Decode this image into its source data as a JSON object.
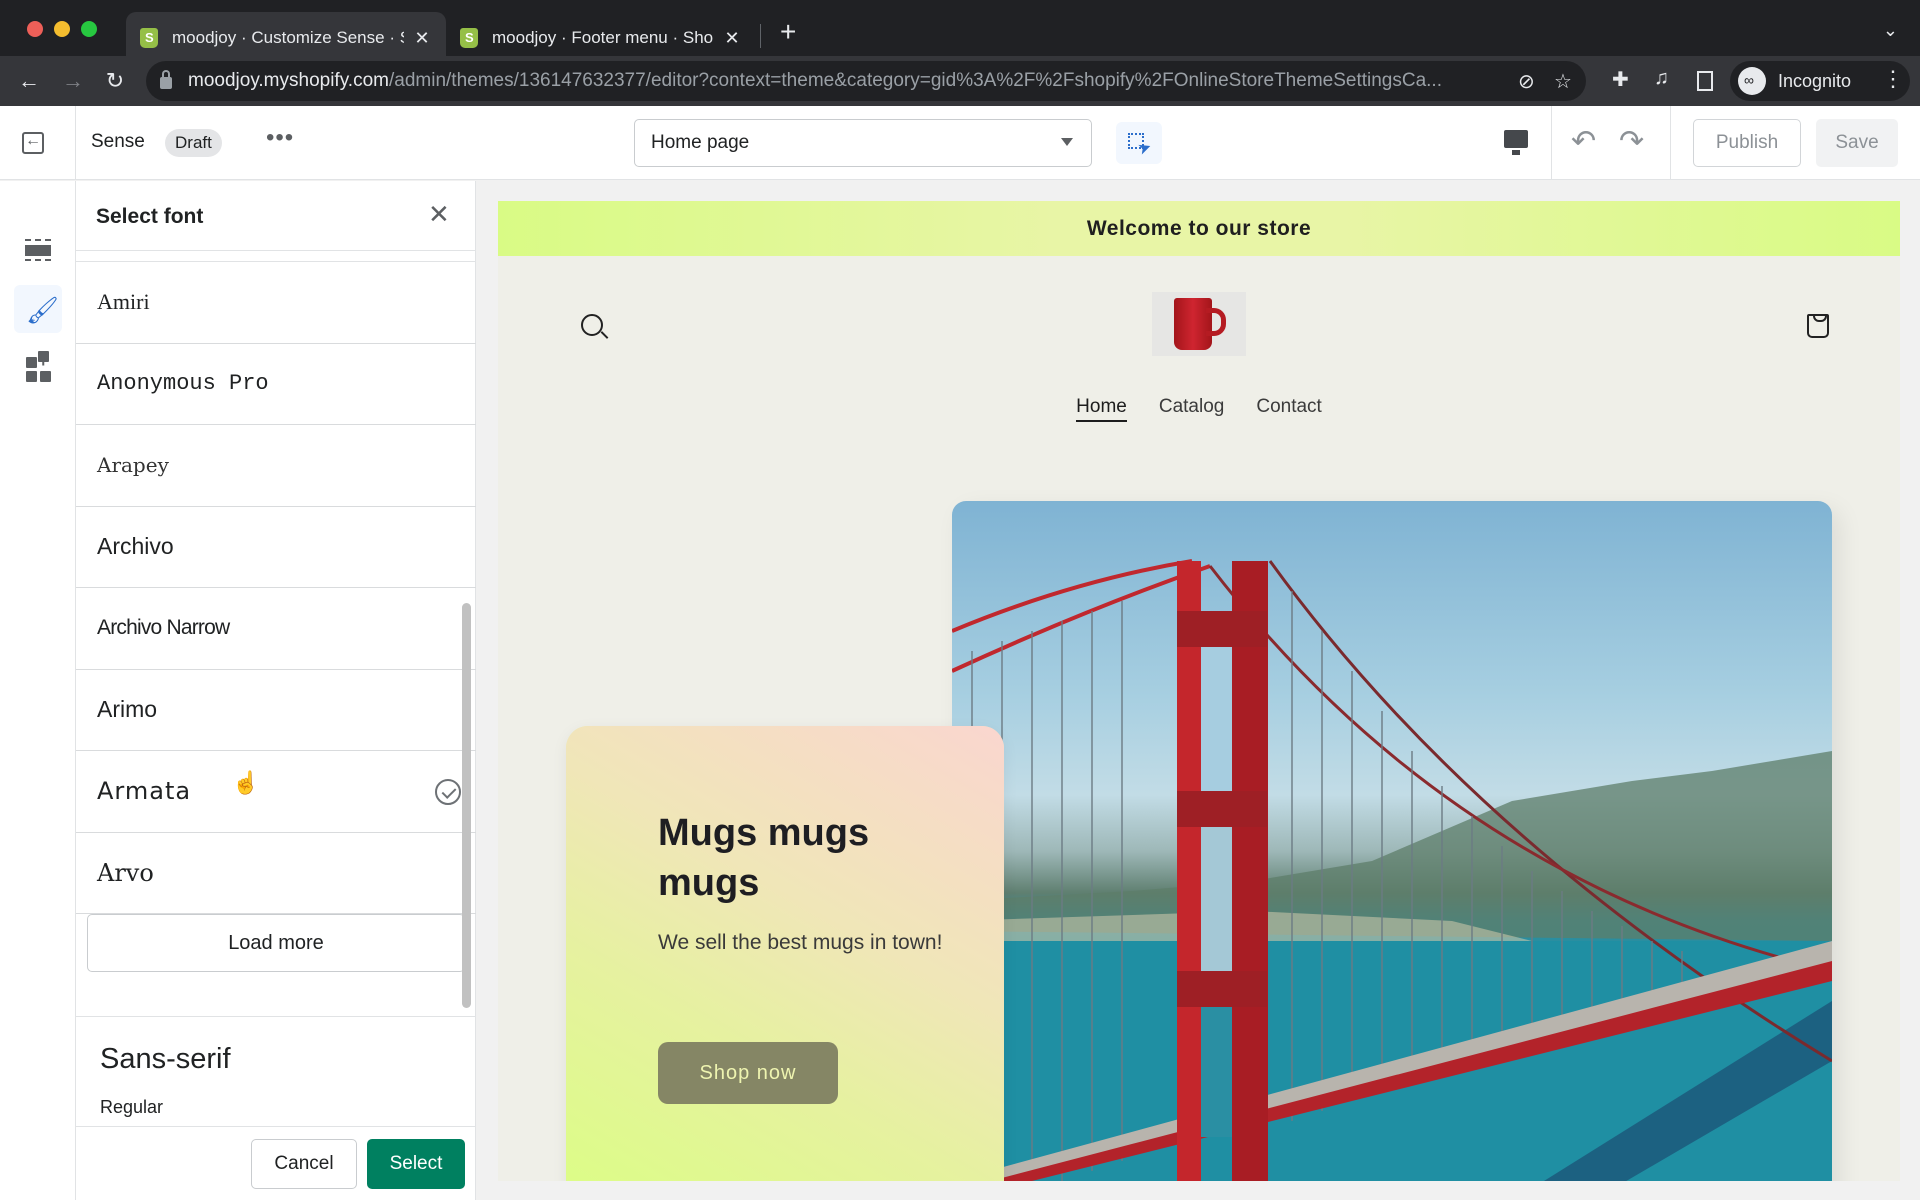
{
  "browser": {
    "tabs": [
      {
        "title": "moodjoy · Customize Sense · S",
        "active": true
      },
      {
        "title": "moodjoy · Footer menu · Shopi",
        "active": false
      }
    ],
    "new_tab": "+",
    "url_host": "moodjoy.myshopify.com",
    "url_path": "/admin/themes/136147632377/editor?context=theme&category=gid%3A%2F%2Fshopify%2FOnlineStoreThemeSettingsCa...",
    "profile_label": "Incognito"
  },
  "topbar": {
    "theme_name": "Sense",
    "status_badge": "Draft",
    "more_label": "•••",
    "page_select": "Home page",
    "publish_label": "Publish",
    "save_label": "Save"
  },
  "font_picker": {
    "title": "Select font",
    "fonts": [
      "Amiri",
      "Anonymous Pro",
      "Arapey",
      "Archivo",
      "Archivo Narrow",
      "Arimo",
      "Armata",
      "Arvo"
    ],
    "selected_font": "Armata",
    "load_more_label": "Load more",
    "preview_name": "Sans-serif",
    "preview_weight": "Regular",
    "cancel_label": "Cancel",
    "select_label": "Select"
  },
  "storefront": {
    "announcement": "Welcome to our store",
    "nav": [
      {
        "label": "Home",
        "active": true
      },
      {
        "label": "Catalog",
        "active": false
      },
      {
        "label": "Contact",
        "active": false
      }
    ],
    "hero": {
      "title": "Mugs mugs mugs",
      "text": "We sell the best mugs in town!",
      "button_label": "Shop now"
    }
  },
  "colors": {
    "accent_blue": "#2c6ecb",
    "select_green": "#008060",
    "announcement_bg": "#d9fb85",
    "shop_button": "#858665"
  }
}
